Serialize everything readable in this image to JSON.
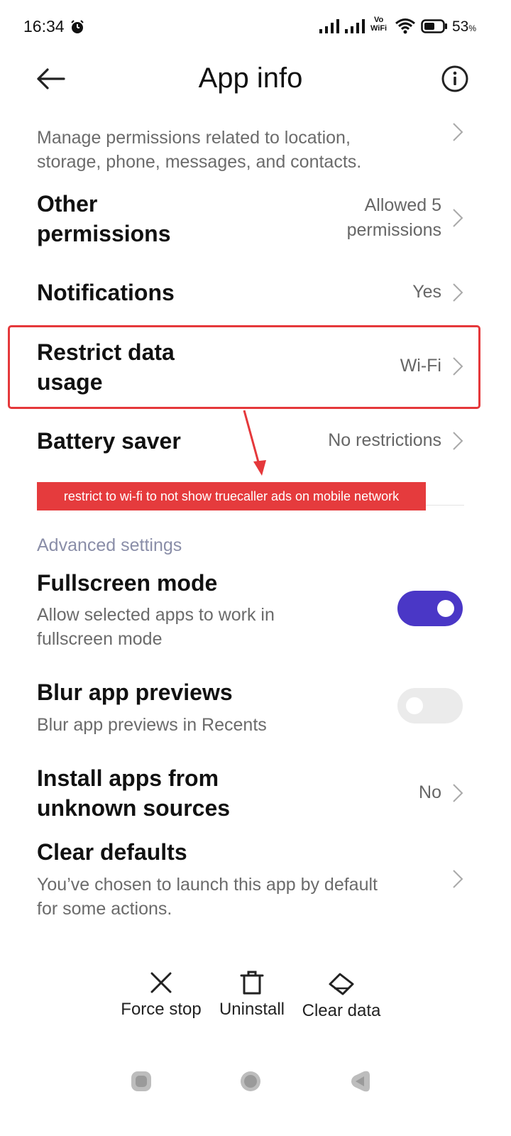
{
  "status_bar": {
    "time": "16:34",
    "vowifi_top": "Vo",
    "vowifi_bottom": "WiFi",
    "battery": "53",
    "battery_unit": "%"
  },
  "header": {
    "title": "App info",
    "back_icon": "arrow-left-icon",
    "info_icon": "info-icon"
  },
  "rows": {
    "app_permissions": {
      "description_line1": "Manage permissions related to location,",
      "description_line2": "storage, phone, messages, and contacts."
    },
    "other_permissions": {
      "title_line1": "Other",
      "title_line2": "permissions",
      "value_line1": "Allowed 5",
      "value_line2": "permissions"
    },
    "notifications": {
      "title": "Notifications",
      "value": "Yes"
    },
    "restrict_data": {
      "title_line1": "Restrict data",
      "title_line2": "usage",
      "value": "Wi-Fi"
    },
    "battery_saver": {
      "title": "Battery saver",
      "value": "No restrictions"
    }
  },
  "annotation": {
    "callout": "restrict to wi-fi to not show truecaller ads on mobile network",
    "color": "#e53b3d"
  },
  "advanced": {
    "header": "Advanced settings",
    "fullscreen": {
      "title": "Fullscreen mode",
      "desc_line1": "Allow selected apps to work in",
      "desc_line2": "fullscreen mode",
      "enabled": true
    },
    "blur": {
      "title": "Blur app previews",
      "desc": "Blur app previews in Recents",
      "enabled": false
    },
    "install_unknown": {
      "title_line1": "Install apps from",
      "title_line2": "unknown sources",
      "value": "No"
    },
    "clear_defaults": {
      "title": "Clear defaults",
      "desc_line1": "You’ve chosen to launch this app by default",
      "desc_line2": "for some actions."
    }
  },
  "actions": {
    "force_stop": "Force stop",
    "uninstall": "Uninstall",
    "clear_data": "Clear data"
  },
  "colors": {
    "accent": "#4a37c6",
    "section_header": "#8a8ea8"
  }
}
